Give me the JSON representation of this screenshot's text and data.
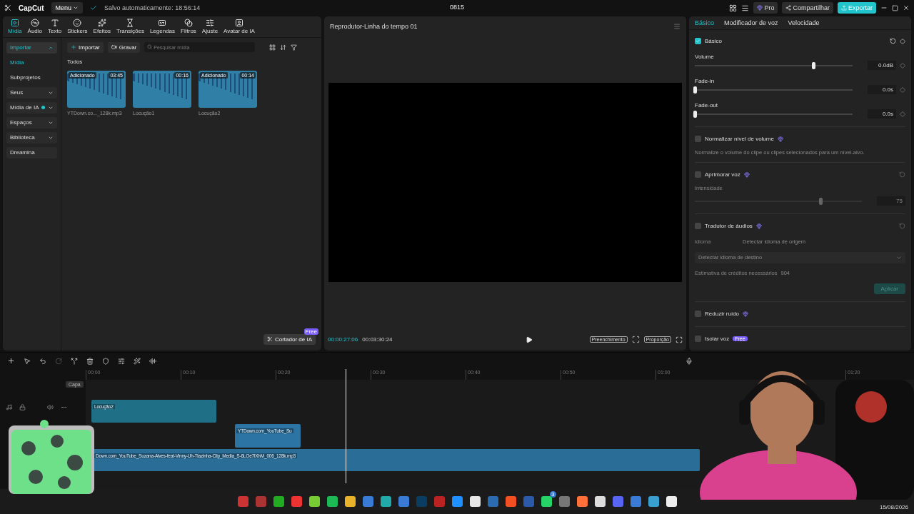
{
  "app": {
    "logo": "CapCut",
    "menu": "Menu",
    "autosave": "Salvo automaticamente: 18:56:14",
    "title": "0815",
    "pro": "Pro",
    "share": "Compartilhar",
    "export": "Exportar"
  },
  "toolbar": [
    {
      "label": "Mídia",
      "selected": true
    },
    {
      "label": "Áudio",
      "selected": false
    },
    {
      "label": "Texto",
      "selected": false
    },
    {
      "label": "Stickers",
      "selected": false
    },
    {
      "label": "Efeitos",
      "selected": false
    },
    {
      "label": "Transições",
      "selected": false
    },
    {
      "label": "Legendas",
      "selected": false
    },
    {
      "label": "Filtros",
      "selected": false
    },
    {
      "label": "Ajuste",
      "selected": false
    },
    {
      "label": "Avatar de IA",
      "selected": false
    }
  ],
  "sidebar": [
    {
      "label": "Importar",
      "selected": true,
      "expanded": true,
      "children": [
        {
          "label": "Mídia",
          "selected": true
        },
        {
          "label": "Subprojetos",
          "selected": false
        }
      ]
    },
    {
      "label": "Seus",
      "selected": false,
      "expanded": false
    },
    {
      "label": "Mídia de IA",
      "selected": false,
      "expanded": false,
      "new": true
    },
    {
      "label": "Espaços",
      "selected": false,
      "expanded": false
    },
    {
      "label": "Biblioteca",
      "selected": false,
      "expanded": false
    },
    {
      "label": "Dreamina",
      "selected": false
    }
  ],
  "media": {
    "import": "Importar",
    "record": "Gravar",
    "search": {
      "placeholder": "Pesquisar mídia"
    },
    "section": "Todos",
    "items": [
      {
        "name": "YTDown.co..._128k.mp3",
        "badge": "Adicionado",
        "duration": "03:45"
      },
      {
        "name": "Locução1",
        "duration": "00:16"
      },
      {
        "name": "Locução2",
        "badge": "Adicionado",
        "duration": "00:14"
      }
    ],
    "ai_cutter": "Cortador de IA",
    "ai_cutter_badge": "Free"
  },
  "player": {
    "title": "Reprodutor-Linha do tempo 01",
    "current": "00:00:27:06",
    "total": "00:03:30:24",
    "fill": "Preenchimento",
    "ratio": "Proporção"
  },
  "inspector": {
    "tabs": [
      {
        "label": "Básico",
        "selected": true
      },
      {
        "label": "Modificador de voz",
        "selected": false
      },
      {
        "label": "Velocidade",
        "selected": false
      }
    ],
    "basic": {
      "title": "Básico",
      "checked": true,
      "sliders": [
        {
          "label": "Volume",
          "level": 0.75,
          "reading": "0.0dB"
        },
        {
          "label": "Fade-in",
          "level": 0,
          "reading": "0.0s"
        },
        {
          "label": "Fade-out",
          "level": 0,
          "reading": "0.0s"
        }
      ]
    },
    "normalize": {
      "title": "Normalizar nível de volume",
      "checked": false,
      "hint": "Normalize o volume do clipe ou clipes selecionados para um nível-alvo."
    },
    "enhance": {
      "title": "Aprimorar voz",
      "checked": false,
      "slider_label": "Intensidade",
      "level": 0.75,
      "reading": "75"
    },
    "translator": {
      "title": "Tradutor de áudios",
      "checked": false,
      "language_label": "Idioma",
      "source": "Detectar idioma de origem",
      "target": "Detectar idioma de destino",
      "credits": "Estimativa de créditos necessários",
      "credit_count": "904",
      "apply": "Aplicar"
    },
    "denoise": {
      "title": "Reduzir ruído",
      "checked": false
    },
    "isolate": {
      "title": "Isolar voz",
      "checked": false,
      "badge": "Free"
    }
  },
  "timeline": {
    "ticks": [
      "00:00",
      "00:10",
      "00:20",
      "00:30",
      "00:40",
      "00:50",
      "01:00",
      "01:20"
    ],
    "cover": "Capa",
    "clips": [
      {
        "name": "Locução2"
      },
      {
        "name": "YTDown.com_YouTube_Su"
      },
      {
        "name": "Down.com_YouTube_Suzana-Alves-feat-Vinny-Uh-Tiazinha-Clip_Media_S-6LOe7lXhM_006_128k.mp3"
      }
    ]
  },
  "taskbar": {
    "whatsapp_badge": "3",
    "date": "15/08/2026"
  }
}
